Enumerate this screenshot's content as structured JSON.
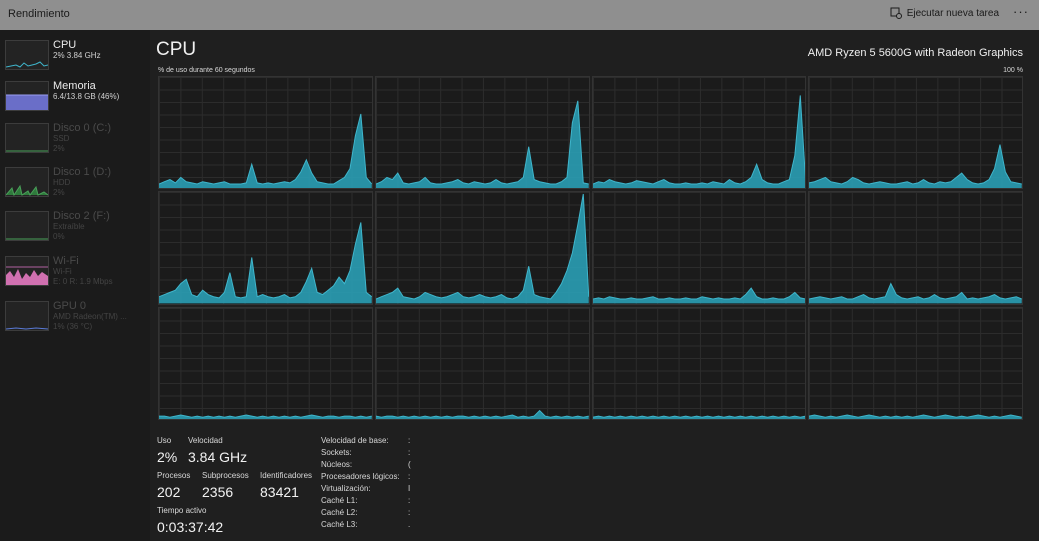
{
  "window": {
    "title": "Rendimiento",
    "new_task_label": "Ejecutar nueva tarea",
    "more_label": "···"
  },
  "sidebar": {
    "items": [
      {
        "name": "CPU",
        "sub": "2%  3.84 GHz",
        "icon": "cpu-graph"
      },
      {
        "name": "Memoria",
        "sub": "6.4/13.8 GB (46%)",
        "icon": "memory-graph"
      },
      {
        "name": "Disco 0 (C:)",
        "sub1": "SSD",
        "sub2": "2%",
        "icon": "disk-graph"
      },
      {
        "name": "Disco 1 (D:)",
        "sub1": "HDD",
        "sub2": "2%",
        "icon": "disk-graph"
      },
      {
        "name": "Disco 2 (F:)",
        "sub1": "Extraíble",
        "sub2": "0%",
        "icon": "disk-graph"
      },
      {
        "name": "Wi-Fi",
        "sub1": "Wi-Fi",
        "sub2": "E: 0 R: 1.9 Mbps",
        "icon": "network-graph"
      },
      {
        "name": "GPU 0",
        "sub1": "AMD Radeon(TM) ...",
        "sub2": "1% (36 °C)",
        "icon": "gpu-graph"
      }
    ]
  },
  "main": {
    "title": "CPU",
    "model": "AMD Ryzen 5 5600G with Radeon Graphics",
    "usage_label": "% de uso durante 60 segundos",
    "usage_max": "100 %"
  },
  "stats": {
    "uso_label": "Uso",
    "uso_value": "2%",
    "velocidad_label": "Velocidad",
    "velocidad_value": "3.84 GHz",
    "procesos_label": "Procesos",
    "procesos_value": "202",
    "subprocesos_label": "Subprocesos",
    "subprocesos_value": "2356",
    "identificadores_label": "Identificadores",
    "identificadores_value": "83421",
    "tiempo_label": "Tiempo activo",
    "tiempo_value": "0:03:37:42"
  },
  "info": {
    "rows": [
      {
        "label": "Velocidad de base:",
        "value": ":"
      },
      {
        "label": "Sockets:",
        "value": ":"
      },
      {
        "label": "Núcleos:",
        "value": "("
      },
      {
        "label": "Procesadores lógicos:",
        "value": ":"
      },
      {
        "label": "Virtualización:",
        "value": "I"
      },
      {
        "label": "Caché L1:",
        "value": ":"
      },
      {
        "label": "Caché L2:",
        "value": ":"
      },
      {
        "label": "Caché L3:",
        "value": "."
      }
    ]
  },
  "colors": {
    "graph_line": "#3fb6cc",
    "graph_fill": "#2a9fb5",
    "memory": "#7b7fd8",
    "wifi": "#d070b0"
  },
  "chart_data": {
    "type": "area",
    "ylim": [
      0,
      100
    ],
    "x_range_seconds": 60,
    "cores": [
      {
        "values": [
          4,
          6,
          8,
          5,
          10,
          6,
          5,
          4,
          6,
          5,
          4,
          5,
          6,
          4,
          4,
          4,
          5,
          22,
          5,
          4,
          5,
          4,
          5,
          6,
          5,
          8,
          15,
          26,
          14,
          6,
          5,
          4,
          4,
          7,
          10,
          18,
          48,
          68,
          10,
          4
        ]
      },
      {
        "values": [
          4,
          6,
          10,
          8,
          14,
          5,
          4,
          5,
          6,
          10,
          5,
          4,
          4,
          5,
          6,
          8,
          5,
          4,
          6,
          5,
          4,
          5,
          8,
          5,
          4,
          5,
          6,
          10,
          38,
          8,
          6,
          5,
          4,
          4,
          6,
          10,
          60,
          80,
          5,
          4
        ]
      },
      {
        "values": [
          4,
          6,
          5,
          8,
          6,
          5,
          4,
          5,
          7,
          6,
          5,
          4,
          6,
          8,
          5,
          4,
          4,
          5,
          4,
          4,
          5,
          4,
          6,
          5,
          4,
          8,
          5,
          4,
          6,
          10,
          22,
          8,
          5,
          4,
          4,
          6,
          8,
          30,
          85,
          5
        ]
      },
      {
        "values": [
          5,
          6,
          8,
          10,
          6,
          5,
          4,
          6,
          10,
          8,
          5,
          4,
          5,
          6,
          5,
          4,
          4,
          5,
          6,
          4,
          5,
          8,
          5,
          4,
          6,
          5,
          6,
          10,
          14,
          8,
          5,
          4,
          5,
          8,
          18,
          40,
          15,
          6,
          5,
          4
        ]
      },
      {
        "values": [
          6,
          8,
          10,
          12,
          18,
          22,
          8,
          6,
          12,
          8,
          6,
          5,
          10,
          28,
          6,
          5,
          6,
          42,
          6,
          8,
          6,
          5,
          6,
          8,
          5,
          6,
          10,
          20,
          32,
          10,
          8,
          12,
          16,
          24,
          18,
          30,
          54,
          74,
          10,
          6
        ]
      },
      {
        "values": [
          4,
          6,
          8,
          10,
          14,
          6,
          5,
          4,
          6,
          10,
          8,
          6,
          5,
          6,
          8,
          10,
          6,
          5,
          6,
          8,
          6,
          5,
          6,
          8,
          5,
          4,
          6,
          12,
          34,
          8,
          6,
          5,
          4,
          10,
          18,
          30,
          46,
          72,
          100,
          6
        ]
      },
      {
        "values": [
          4,
          5,
          4,
          6,
          5,
          4,
          4,
          5,
          4,
          4,
          5,
          6,
          4,
          4,
          5,
          4,
          4,
          5,
          4,
          4,
          6,
          5,
          4,
          5,
          4,
          4,
          5,
          4,
          8,
          14,
          6,
          4,
          4,
          5,
          4,
          4,
          6,
          10,
          5,
          4
        ]
      },
      {
        "values": [
          4,
          5,
          6,
          5,
          4,
          5,
          6,
          4,
          4,
          6,
          8,
          5,
          4,
          5,
          6,
          18,
          8,
          5,
          4,
          5,
          6,
          4,
          5,
          8,
          5,
          4,
          5,
          6,
          10,
          4,
          5,
          4,
          5,
          6,
          8,
          5,
          4,
          5,
          6,
          4
        ]
      },
      {
        "values": [
          3,
          3,
          2,
          3,
          4,
          3,
          2,
          3,
          2,
          3,
          2,
          3,
          2,
          3,
          2,
          3,
          4,
          3,
          2,
          3,
          2,
          3,
          2,
          3,
          2,
          3,
          2,
          3,
          4,
          3,
          2,
          3,
          3,
          2,
          3,
          3,
          2,
          3,
          2,
          3
        ]
      },
      {
        "values": [
          3,
          2,
          3,
          3,
          2,
          3,
          2,
          3,
          2,
          3,
          2,
          3,
          2,
          3,
          2,
          3,
          3,
          2,
          3,
          2,
          3,
          2,
          3,
          2,
          3,
          4,
          2,
          3,
          2,
          3,
          8,
          3,
          2,
          3,
          2,
          3,
          2,
          3,
          2,
          3
        ]
      },
      {
        "values": [
          2,
          3,
          2,
          3,
          2,
          3,
          2,
          3,
          2,
          3,
          2,
          3,
          2,
          3,
          2,
          3,
          2,
          3,
          2,
          3,
          2,
          3,
          2,
          3,
          2,
          3,
          2,
          3,
          2,
          3,
          2,
          3,
          2,
          3,
          2,
          3,
          2,
          3,
          2,
          3
        ]
      },
      {
        "values": [
          3,
          4,
          3,
          2,
          3,
          2,
          3,
          4,
          3,
          2,
          3,
          4,
          3,
          2,
          3,
          2,
          3,
          2,
          3,
          2,
          3,
          4,
          3,
          2,
          3,
          4,
          3,
          2,
          3,
          2,
          3,
          4,
          3,
          2,
          3,
          2,
          3,
          4,
          3,
          2
        ]
      }
    ]
  }
}
